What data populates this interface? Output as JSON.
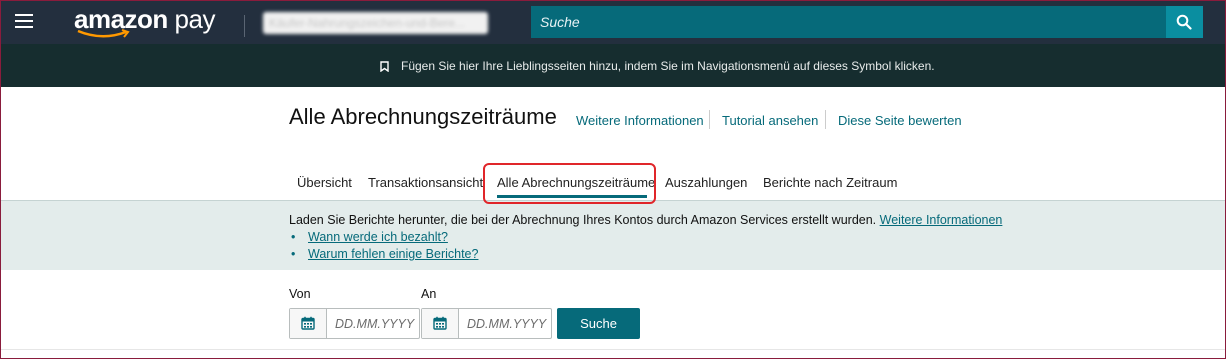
{
  "header": {
    "logo_brand": "amazon",
    "logo_product": "pay",
    "account_selector": "Käufer-Nahrungszeichen-und-Bere...",
    "search_placeholder": "Suche"
  },
  "notice": {
    "text": "Fügen Sie hier Ihre Lieblingsseiten hinzu, indem Sie im Navigationsmenü auf dieses Symbol klicken."
  },
  "page": {
    "title": "Alle Abrechnungszeiträume",
    "links": [
      "Weitere Informationen",
      "Tutorial ansehen",
      "Diese Seite bewerten"
    ]
  },
  "tabs": [
    {
      "label": "Übersicht"
    },
    {
      "label": "Transaktionsansicht"
    },
    {
      "label": "Alle Abrechnungszeiträume",
      "active": true
    },
    {
      "label": "Auszahlungen"
    },
    {
      "label": "Berichte nach Zeitraum"
    }
  ],
  "info": {
    "text": "Laden Sie Berichte herunter, die bei der Abrechnung Ihres Kontos durch Amazon Services erstellt wurden.",
    "link": "Weitere Informationen",
    "bullets": [
      "Wann werde ich bezahlt?",
      "Warum fehlen einige Berichte?"
    ]
  },
  "filters": {
    "from_label": "Von",
    "to_label": "An",
    "date_placeholder": "DD.MM.YYYY",
    "search_button": "Suche"
  },
  "colors": {
    "topbar": "#232f3e",
    "notice_bar": "#162d2f",
    "accent_teal": "#066a7a",
    "info_band": "#e3eceb",
    "highlight_red": "#e0262a"
  }
}
